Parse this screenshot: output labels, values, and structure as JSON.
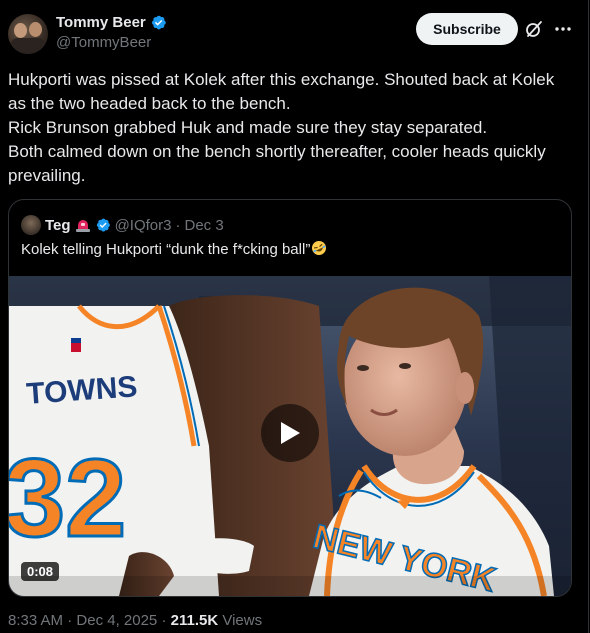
{
  "author": {
    "display_name": "Tommy Beer",
    "handle": "@TommyBeer"
  },
  "header": {
    "subscribe_label": "Subscribe",
    "icons": [
      "verified-badge-icon",
      "grok-icon",
      "more-icon"
    ]
  },
  "tweet": {
    "lines": [
      "Hukporti was pissed at Kolek after this exchange. Shouted back at Kolek",
      "as the two headed back to the bench.",
      "Rick Brunson grabbed Huk and made sure they stay separated.",
      "Both calmed down on the bench shortly thereafter, cooler heads quickly",
      "prevailing."
    ]
  },
  "quote": {
    "display_name": "Teg",
    "handle": "@IQfor3",
    "separator": "·",
    "date": "Dec 3",
    "text": "Kolek telling Hukporti “dunk the f*cking ball”",
    "emoji": "rolling-on-floor-laughing-emoji",
    "video": {
      "duration": "0:08",
      "jersey_number": "32",
      "jersey_name": "TOWNS",
      "jersey_team": "NEW YORK"
    }
  },
  "meta": {
    "time": "8:33 AM",
    "separator": "·",
    "date": "Dec 4, 2025",
    "views_count": "211.5K",
    "views_label": "Views"
  },
  "colors": {
    "background": "#000000",
    "text_primary": "#e7e9ea",
    "text_secondary": "#71767b",
    "verified_blue": "#1d9bf0",
    "border": "#2f3336",
    "knicks_orange": "#f58426",
    "knicks_blue": "#006bb6"
  }
}
